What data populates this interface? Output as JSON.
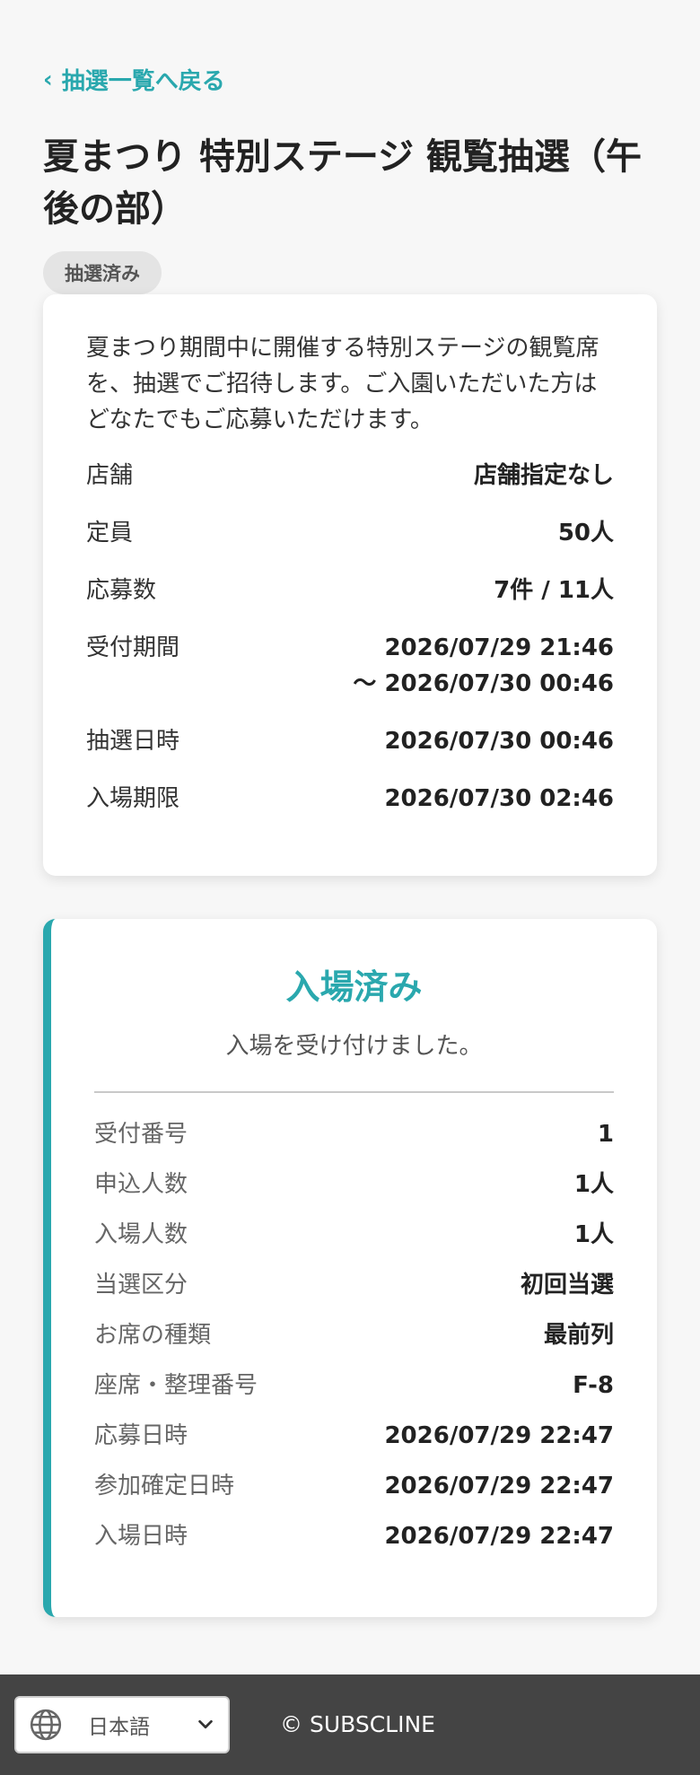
{
  "nav": {
    "back_label": "抽選一覧へ戻る"
  },
  "page": {
    "title": "夏まつり 特別ステージ 観覧抽選（午後の部）",
    "status_badge": "抽選済み"
  },
  "info": {
    "description": "夏まつり期間中に開催する特別ステージの観覧席を、抽選でご招待します。ご入園いただいた方はどなたでもご応募いただけます。",
    "rows": [
      {
        "label": "店舗",
        "value": "店舗指定なし"
      },
      {
        "label": "定員",
        "value": "50人"
      },
      {
        "label": "応募数",
        "value": "7件 / 11人"
      },
      {
        "label": "受付期間",
        "value": "2026/07/29 21:46",
        "value2": "〜 2026/07/30 00:46"
      },
      {
        "label": "抽選日時",
        "value": "2026/07/30 00:46"
      },
      {
        "label": "入場期限",
        "value": "2026/07/30 02:46"
      }
    ]
  },
  "status": {
    "title": "入場済み",
    "message": "入場を受け付けました。",
    "rows": [
      {
        "label": "受付番号",
        "value": "1"
      },
      {
        "label": "申込人数",
        "value": "1人"
      },
      {
        "label": "入場人数",
        "value": "1人"
      },
      {
        "label": "当選区分",
        "value": "初回当選"
      },
      {
        "label": "お席の種類",
        "value": "最前列"
      },
      {
        "label": "座席・整理番号",
        "value": "F-8"
      },
      {
        "label": "応募日時",
        "value": "2026/07/29 22:47"
      },
      {
        "label": "参加確定日時",
        "value": "2026/07/29 22:47"
      },
      {
        "label": "入場日時",
        "value": "2026/07/29 22:47"
      }
    ]
  },
  "footer": {
    "language": "日本語",
    "copyright": "© SUBSCLINE"
  },
  "colors": {
    "accent": "#2aa8ae",
    "footer_bg": "#444444",
    "badge_bg": "#e4e4e4"
  },
  "icons": {
    "back": "chevron-left-icon",
    "language": "globe-icon",
    "dropdown": "chevron-down-icon"
  }
}
